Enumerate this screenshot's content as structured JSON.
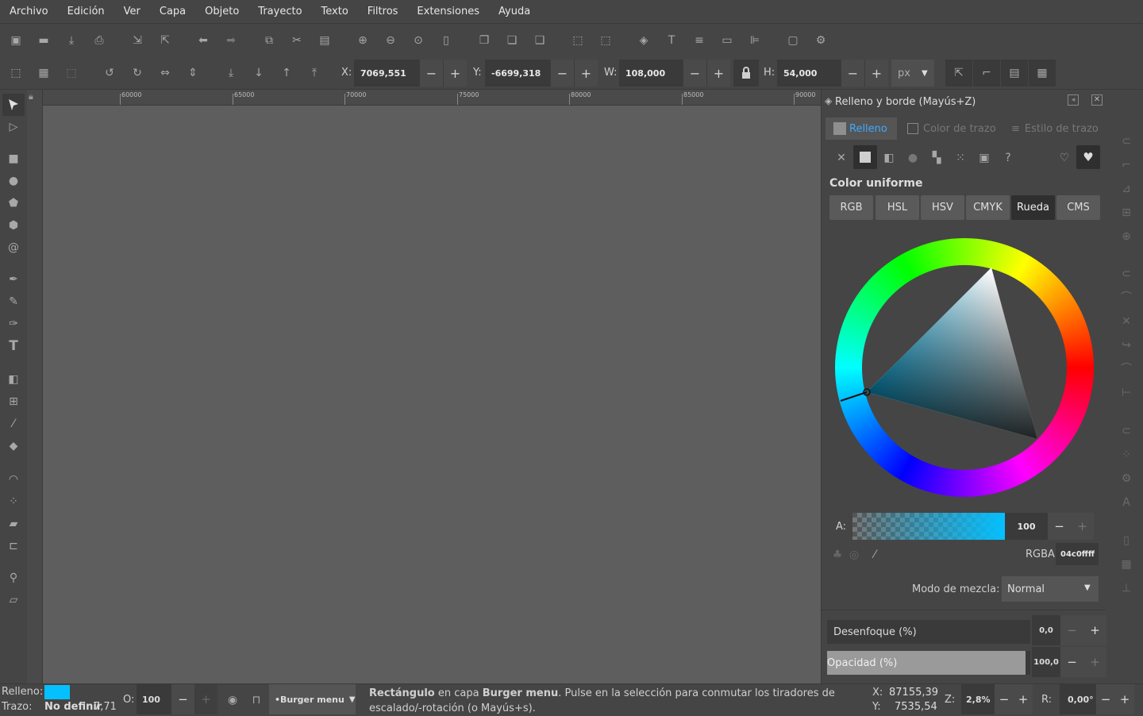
{
  "menu": [
    "Archivo",
    "Edición",
    "Ver",
    "Capa",
    "Objeto",
    "Trayecto",
    "Texto",
    "Filtros",
    "Extensiones",
    "Ayuda"
  ],
  "controls": {
    "x_label": "X:",
    "x_value": "7069,551",
    "y_label": "Y:",
    "y_value": "-6699,318",
    "w_label": "W:",
    "w_value": "108,000",
    "h_label": "H:",
    "h_value": "54,000",
    "unit": "px"
  },
  "ruler": {
    "ticks": [
      "60000",
      "65000",
      "70000",
      "75000",
      "80000",
      "85000",
      "90000"
    ]
  },
  "panel": {
    "title": "Relleno y borde (Mayús+Z)",
    "tabs": [
      "Relleno",
      "Color de trazo",
      "Estilo de trazo"
    ],
    "color_heading": "Color uniforme",
    "modes": [
      "RGB",
      "HSL",
      "HSV",
      "CMYK",
      "Rueda",
      "CMS"
    ],
    "active_mode": "Rueda",
    "alpha_label": "A:",
    "alpha_value": "100",
    "rgba_label": "RGBA:",
    "rgba_value": "04c0ffff",
    "blend_label": "Modo de mezcla:",
    "blend_value": "Normal",
    "blur_label": "Desenfoque (%)",
    "blur_value": "0,0",
    "opacity_label": "Opacidad (%)",
    "opacity_value": "100,0",
    "accent": "#04c0ff"
  },
  "status": {
    "fill_label": "Relleno:",
    "stroke_label": "Trazo:",
    "stroke_value": "No definir",
    "stroke_width": "7,71",
    "o_label": "O:",
    "o_value": "100",
    "layer": "•Burger menu",
    "msg_obj": "Rectángulo",
    "msg_in": " en capa ",
    "msg_layer": "Burger menu",
    "msg_rest": ". Pulse en la selección para conmutar los tiradores de escalado/-rotación (o Mayús+s).",
    "cx_label": "X:",
    "cx_value": "87155,39",
    "cy_label": "Y:",
    "cy_value": "7535,54",
    "z_label": "Z:",
    "z_value": "2,8%",
    "r_label": "R:",
    "r_value": "0,00°"
  }
}
